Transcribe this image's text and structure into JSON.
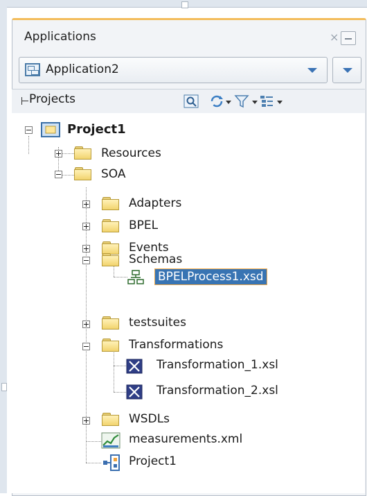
{
  "panel": {
    "title": "Applications",
    "close_glyph": "×",
    "application_selector": {
      "selected": "Application2"
    },
    "projects_label": "Projects",
    "toolbar_icons": [
      "working-sets-icon",
      "sync-icon",
      "filter-icon",
      "display-options-icon"
    ]
  },
  "tree": {
    "root": "Project1",
    "resources": "Resources",
    "soa": "SOA",
    "adapters": "Adapters",
    "bpel": "BPEL",
    "events": "Events",
    "schemas": "Schemas",
    "xsd": "BPELProcess1.xsd",
    "testsuites": "testsuites",
    "transformations": "Transformations",
    "xsl1": "Transformation_1.xsl",
    "xsl2": "Transformation_2.xsl",
    "wsdls": "WSDLs",
    "measurements": "measurements.xml",
    "composite": "Project1"
  }
}
